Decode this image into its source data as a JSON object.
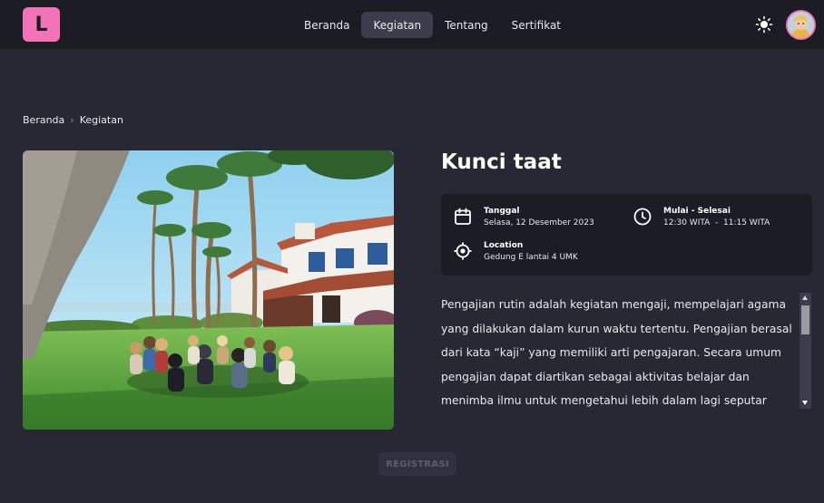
{
  "navbar": {
    "logo_letter": "L",
    "links": [
      {
        "label": "Beranda",
        "active": false
      },
      {
        "label": "Kegiatan",
        "active": true
      },
      {
        "label": "Tentang",
        "active": false
      },
      {
        "label": "Sertifikat",
        "active": false
      }
    ],
    "theme_icon": "sun-icon",
    "avatar_icon": "user-avatar"
  },
  "breadcrumb": {
    "home": "Beranda",
    "current": "Kegiatan"
  },
  "event": {
    "title": "Kunci taat",
    "date_label": "Tanggal",
    "date_value": "Selasa, 12 Desember 2023",
    "time_label": "Mulai - Selesai",
    "time_value": "12:30 WITA  -  11:15 WITA",
    "location_label": "Location",
    "location_value": "Gedung E lantai 4 UMK",
    "description": "Pengajian rutin adalah kegiatan mengaji, mempelajari agama yang dilakukan dalam kurun waktu tertentu. Pengajian berasal dari kata “kaji” yang memiliki arti pengajaran. Secara umum pengajian dapat diartikan sebagai aktivitas belajar dan menimba ilmu untuk mengetahui lebih dalam lagi seputar ajaran agama Islam. Sebagai"
  },
  "register_button": "REGISTRASI",
  "colors": {
    "background": "#272833",
    "navbar": "#1b1c24",
    "brand_pink": "#f472b6",
    "nav_active": "#3b3d4c"
  }
}
